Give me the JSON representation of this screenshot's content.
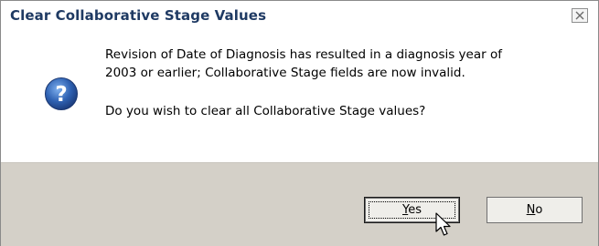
{
  "dialog": {
    "title": "Clear Collaborative Stage Values",
    "close_label": "×",
    "message_line1": "Revision of Date of Diagnosis has resulted in a diagnosis year of",
    "message_line2": "2003 or earlier; Collaborative Stage fields are now invalid.",
    "question": "Do you wish to clear all Collaborative Stage values?",
    "icon": "question-icon",
    "yes": {
      "mnemonic": "Y",
      "rest": "es"
    },
    "no": {
      "mnemonic": "N",
      "rest": "o"
    }
  },
  "colors": {
    "title_text": "#1f3a63",
    "footer_bg": "#d4d0c8",
    "icon_blue": "#2f62b3"
  }
}
